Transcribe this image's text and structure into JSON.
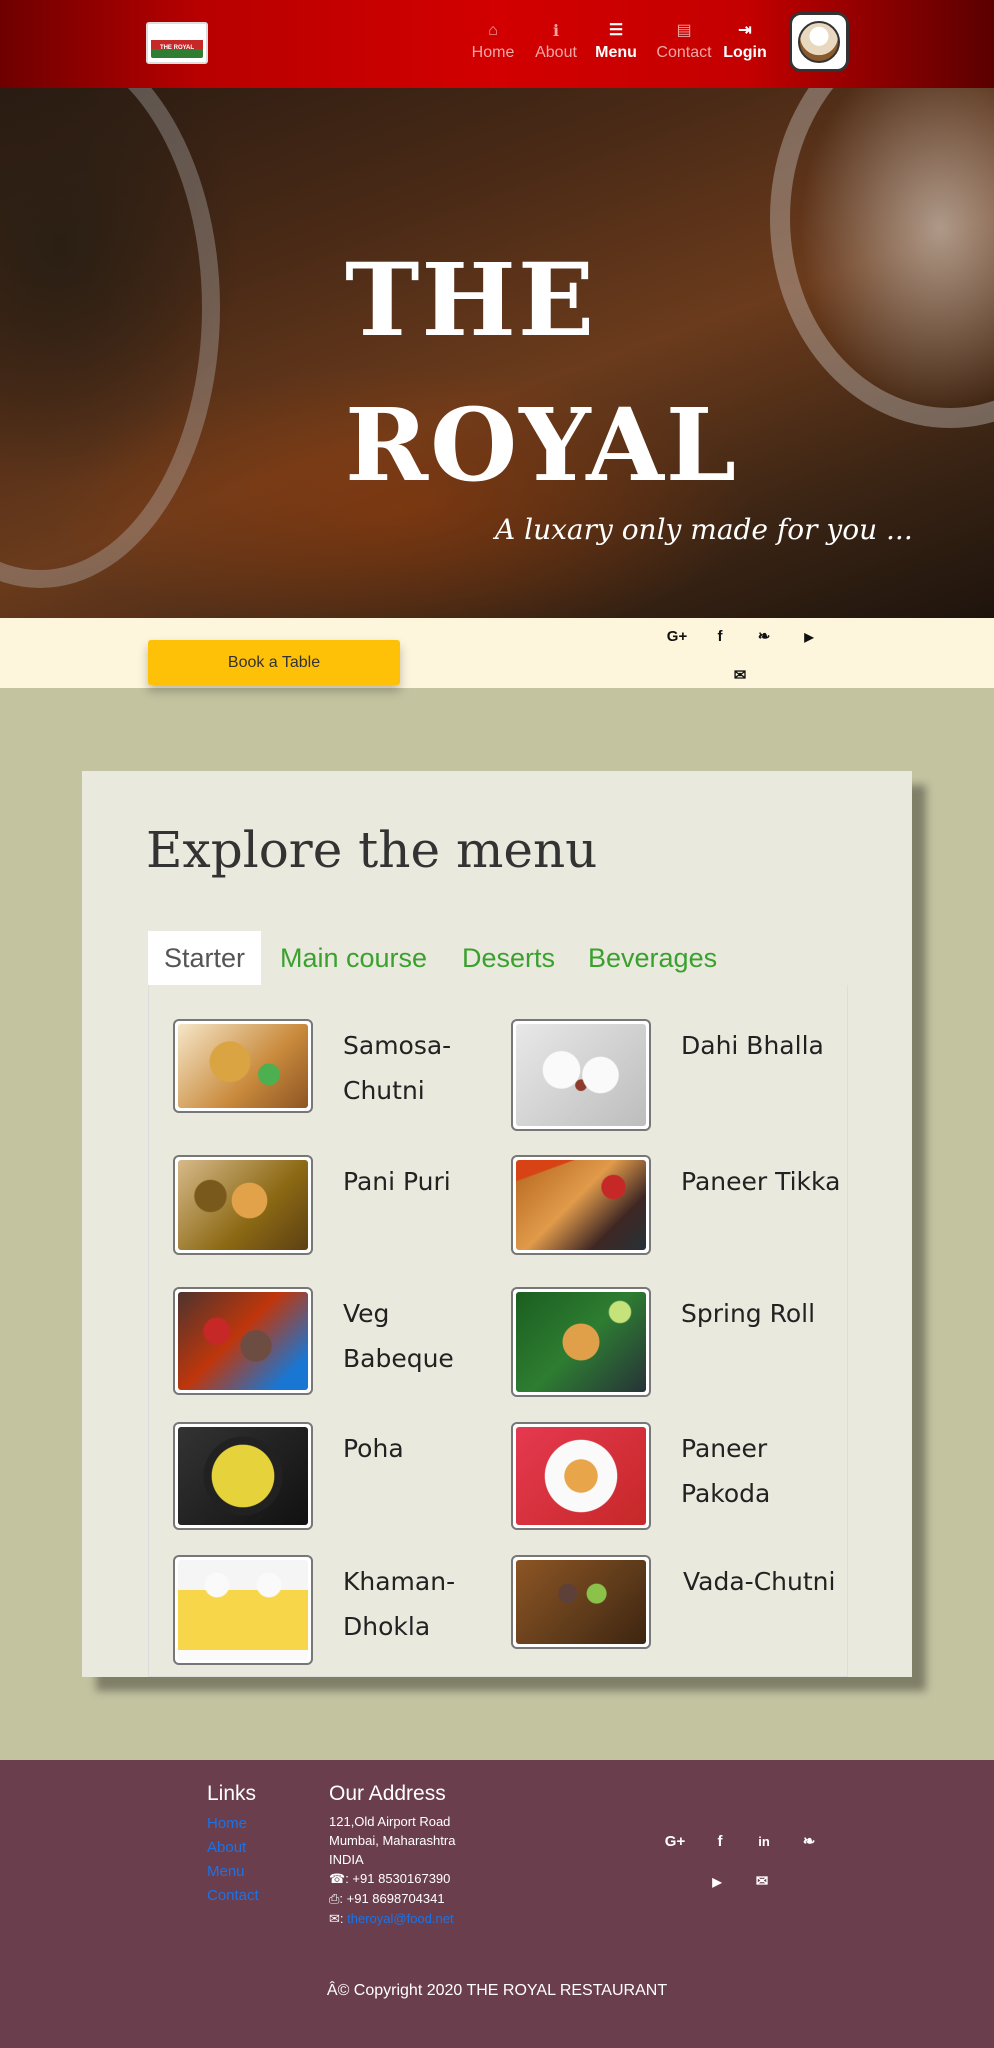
{
  "nav": {
    "brand_logo_text": "THE ROYAL",
    "items": [
      {
        "label": "Home",
        "icon": "home-icon",
        "glyph": "⌂"
      },
      {
        "label": "About",
        "icon": "info-icon",
        "glyph": "i"
      },
      {
        "label": "Menu",
        "icon": "list-icon",
        "glyph": "☰",
        "active": true
      },
      {
        "label": "Contact",
        "icon": "contact-card-icon",
        "glyph": "▤"
      },
      {
        "label": "Login",
        "icon": "login-icon",
        "glyph": "⇥"
      }
    ]
  },
  "hero": {
    "title_line1": "THE",
    "title_line2": "ROYAL",
    "tagline": "A luxary only made for you ..."
  },
  "booking": {
    "book_label": "Book a Table",
    "social": [
      {
        "icon": "google-plus-icon",
        "glyph": "G+"
      },
      {
        "icon": "facebook-icon",
        "glyph": "f"
      },
      {
        "icon": "twitter-icon",
        "glyph": "❧"
      },
      {
        "icon": "youtube-icon",
        "glyph": "▶"
      },
      {
        "icon": "email-icon",
        "glyph": "✉"
      }
    ]
  },
  "menu": {
    "title": "Explore the menu",
    "tabs": [
      "Starter",
      "Main course",
      "Deserts",
      "Beverages"
    ],
    "active_tab": "Starter",
    "dishes": [
      {
        "name": "Samosa-Chutni"
      },
      {
        "name": "Dahi Bhalla"
      },
      {
        "name": "Pani Puri"
      },
      {
        "name": "Paneer Tikka"
      },
      {
        "name": "Veg Babeque"
      },
      {
        "name": "Spring Roll"
      },
      {
        "name": "Poha"
      },
      {
        "name": "Paneer Pakoda"
      },
      {
        "name": "Khaman-Dhokla"
      },
      {
        "name": "Vada-Chutni"
      }
    ]
  },
  "footer": {
    "links_heading": "Links",
    "links": [
      "Home",
      "About",
      "Menu",
      "Contact"
    ],
    "address_heading": "Our Address",
    "address_lines": [
      "121,Old Airport Road",
      "Mumbai, Maharashtra",
      "INDIA"
    ],
    "phone": ": +91 8530167390",
    "fax": ": +91 8698704341",
    "email": "theroyal@food.net",
    "social": [
      {
        "icon": "google-plus-icon",
        "glyph": "G+"
      },
      {
        "icon": "facebook-icon",
        "glyph": "f"
      },
      {
        "icon": "linkedin-icon",
        "glyph": "in"
      },
      {
        "icon": "twitter-icon",
        "glyph": "❧"
      },
      {
        "icon": "youtube-icon",
        "glyph": "▶"
      },
      {
        "icon": "email-icon",
        "glyph": "✉"
      }
    ],
    "copyright": "Â© Copyright 2020 THE ROYAL RESTAURANT"
  },
  "colors": {
    "navbar": "#d20000",
    "accent_button": "#ffc107",
    "tab_link": "#3aa12f",
    "footer_bg": "#6a3e4c",
    "section_bg": "#c3c3a0"
  }
}
